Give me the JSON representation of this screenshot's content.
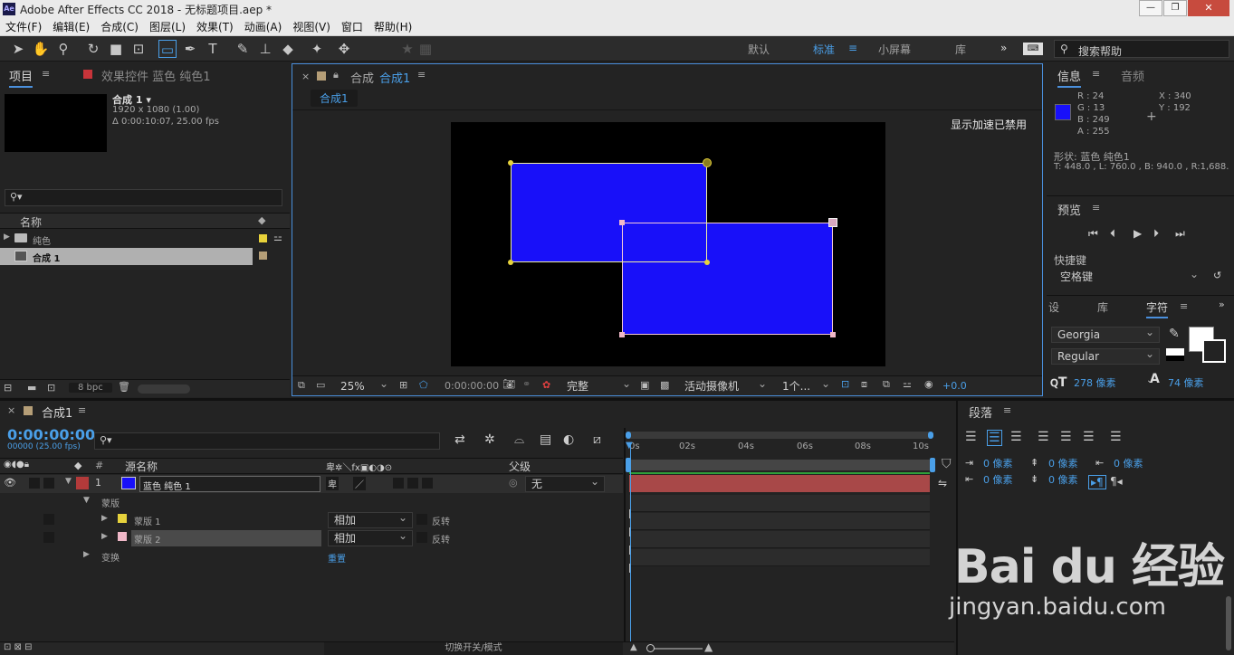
{
  "app": {
    "title": "Adobe After Effects CC 2018 - 无标题项目.aep *",
    "logo": "Ae"
  },
  "window_controls": {
    "minimize": "—",
    "restore": "❐",
    "close": "✕"
  },
  "menu": [
    "文件(F)",
    "编辑(E)",
    "合成(C)",
    "图层(L)",
    "效果(T)",
    "动画(A)",
    "视图(V)",
    "窗口",
    "帮助(H)"
  ],
  "workspaces": [
    "默认",
    "标准",
    "小屏幕",
    "库"
  ],
  "workspace_active": "标准",
  "search_help_placeholder": "搜索帮助",
  "project_panel": {
    "tab_project": "项目",
    "tab_effects": "效果控件 蓝色 纯色1",
    "comp_name": "合成 1 ▾",
    "comp_size": "1920 x 1080 (1.00)",
    "comp_duration": "Δ 0:00:10:07, 25.00 fps",
    "col_name": "名称",
    "items": [
      {
        "name": "纯色",
        "type": "folder",
        "color": "#e8d23a"
      },
      {
        "name": "合成 1",
        "type": "comp",
        "color": "#b59e77"
      }
    ],
    "bpc": "8 bpc"
  },
  "comp_panel": {
    "tab": "合成 合成1",
    "tab_prefix": "合成",
    "tab_name": "合成1",
    "breadcrumb": "合成1",
    "gpu_note": "显示加速已禁用",
    "zoom": "25%",
    "timecode": "0:00:00:00",
    "resolution": "完整",
    "camera": "活动摄像机",
    "views": "1个...",
    "exposure": "+0.0"
  },
  "info_panel": {
    "tab_info": "信息",
    "tab_audio": "音频",
    "r": "R : 24",
    "g": "G : 13",
    "b": "B : 249",
    "a": "A : 255",
    "x": "X : 340",
    "y": "Y : 192",
    "shape": "形状: 蓝色 纯色1",
    "bounds": "T: 448.0 ,  L: 760.0 ,  B: 940.0 ,  R:1,688.",
    "swatch_color": "#1810f9"
  },
  "preview_panel": {
    "title": "预览",
    "shortcut_label": "快捷键",
    "shortcut_value": "空格键"
  },
  "char_panel": {
    "tab_1": "设",
    "tab_2": "库",
    "tab_3": "字符",
    "font": "Georgia",
    "style": "Regular",
    "size": "278 像素",
    "leading": "74 像素",
    "leading_icon_label": "A"
  },
  "para_panel": {
    "title": "段落",
    "indent_left": "0 像素",
    "indent_right": "0 像素",
    "space_before": "0 像素",
    "space_after": "0 像素"
  },
  "timeline": {
    "tab": "合成1",
    "timecode": "0:00:00:00",
    "frame_info": "00000 (25.00 fps)",
    "col_source": "源名称",
    "col_parent": "父级",
    "ruler": [
      "0s",
      "02s",
      "04s",
      "06s",
      "08s",
      "10s"
    ],
    "layer_num": "1",
    "layer_name": "蓝色 纯色 1",
    "layer_color": "#b33a3a",
    "parent_value": "无",
    "masks_label": "蒙版",
    "mask1": "蒙版 1",
    "mask2": "蒙版 2",
    "mask_mode": "相加",
    "invert": "反转",
    "transform": "变换",
    "reset": "重置",
    "toggle_label": "切换开关/模式"
  },
  "watermark": {
    "brand": "Bai du 经验",
    "url": "jingyan.baidu.com"
  },
  "colors": {
    "accent": "#4a9fe8",
    "solid": "#1810f9",
    "layer_bar": "#a84848",
    "mask1": "#e6d23c",
    "mask2": "#f0b8c8"
  }
}
